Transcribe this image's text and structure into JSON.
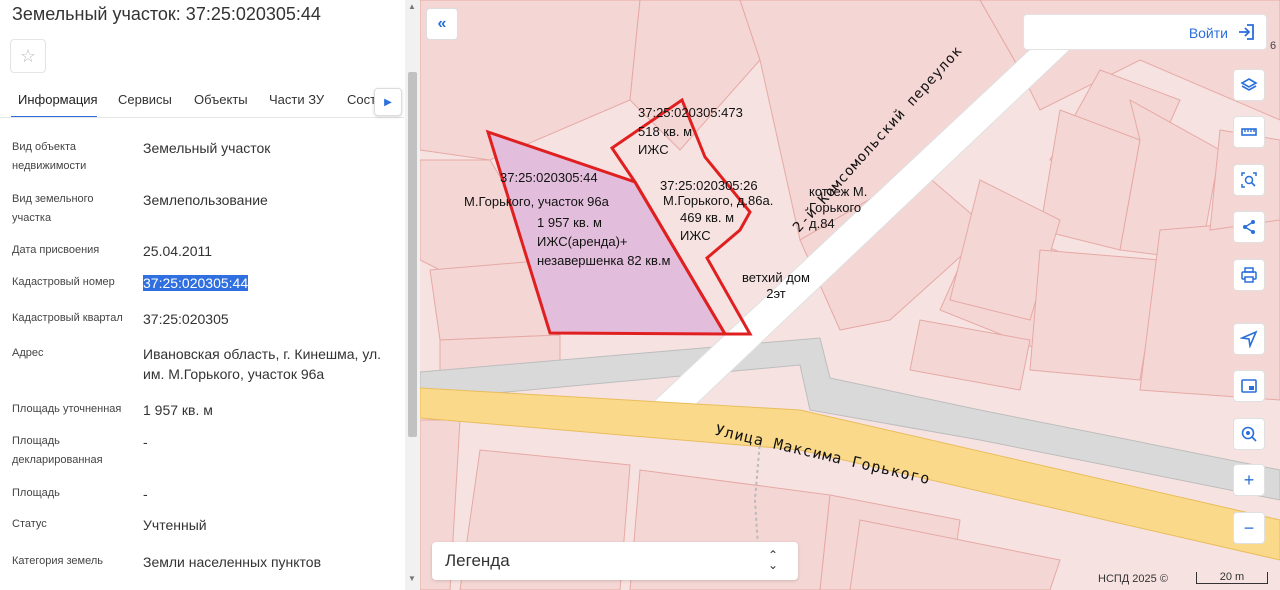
{
  "panel": {
    "title": "Земельный участок: 37:25:020305:44",
    "favorite_icon": "star-icon",
    "tabs": [
      {
        "label": "Информация"
      },
      {
        "label": "Сервисы"
      },
      {
        "label": "Объекты"
      },
      {
        "label": "Части ЗУ"
      },
      {
        "label": "Состав"
      }
    ],
    "fields": [
      {
        "label": "Вид объекта недвижимости",
        "value": "Земельный участок"
      },
      {
        "label": "Вид земельного участка",
        "value": "Землепользование"
      },
      {
        "label": "Дата присвоения",
        "value": "25.04.2011"
      },
      {
        "label": "Кадастровый номер",
        "value": "37:25:020305:44"
      },
      {
        "label": "Кадастровый квартал",
        "value": "37:25:020305"
      },
      {
        "label": "Адрес",
        "value": "Ивановская область, г. Кинешма, ул. им. М.Горького, участок 96а"
      },
      {
        "label": "Площадь уточненная",
        "value": "1 957 кв. м"
      },
      {
        "label": "Площадь декларированная",
        "value": "-"
      },
      {
        "label": "Площадь",
        "value": "-"
      },
      {
        "label": "Статус",
        "value": "Учтенный"
      },
      {
        "label": "Категория земель",
        "value": "Земли населенных пунктов"
      }
    ]
  },
  "map": {
    "labels": {
      "parcel_473": "37:25:020305:473",
      "area_473": "518 кв. м",
      "use_473": "ИЖС",
      "parcel_44": "37:25:020305:44",
      "addr_44": "М.Горького, участок 96а",
      "area_44": "1 957 кв. м",
      "use_44": "ИЖС(аренда)+",
      "note_44": "незавершенка 82 кв.м",
      "parcel_26": "37:25:020305:26",
      "addr_26": "М.Горького, д.86а.",
      "area_26": "469 кв. м",
      "use_26": "ИЖС",
      "cottage": "коттеж М. Горького д.84",
      "old_house": "ветхий дом 2эт",
      "street_1": "2-й Комсомольский переулок",
      "street_2": "Улица Максима Горького",
      "edge_label": "6"
    },
    "parcel_highlight_color": "#e02020",
    "parcel_fill_color": "#e3bedc"
  },
  "login": {
    "label": "Войти"
  },
  "legend": {
    "label": "Легенда"
  },
  "attribution": "НСПД 2025 ©",
  "scale": "20 m"
}
